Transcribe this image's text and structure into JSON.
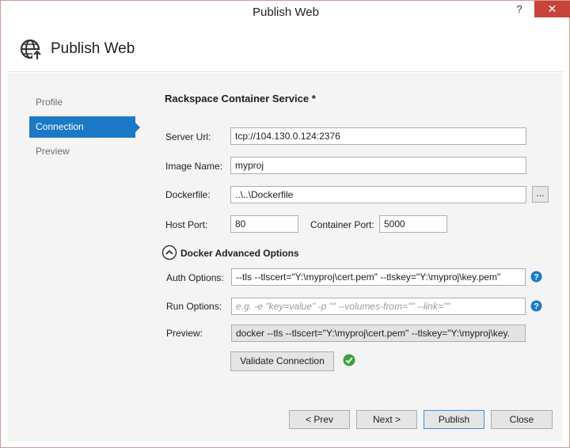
{
  "window": {
    "title": "Publish Web",
    "help_glyph": "?",
    "close_glyph": "✕"
  },
  "header": {
    "title": "Publish Web",
    "icon": "globe-publish-icon"
  },
  "nav": {
    "items": [
      {
        "label": "Profile",
        "active": false
      },
      {
        "label": "Connection",
        "active": true
      },
      {
        "label": "Preview",
        "active": false
      }
    ]
  },
  "form": {
    "section_title": "Rackspace Container Service *",
    "server_url": {
      "label": "Server Url:",
      "value": "tcp://104.130.0.124:2376"
    },
    "image_name": {
      "label": "Image Name:",
      "value": "myproj"
    },
    "dockerfile": {
      "label": "Dockerfile:",
      "value": "..\\..\\Dockerfile",
      "browse_label": "..."
    },
    "host_port": {
      "label": "Host Port:",
      "value": "80"
    },
    "container_port": {
      "label": "Container Port:",
      "value": "5000"
    },
    "advanced": {
      "label": "Docker Advanced Options",
      "expanded": true,
      "auth_options": {
        "label": "Auth Options:",
        "value": "--tls --tlscert=\"Y:\\myproj\\cert.pem\" --tlskey=\"Y:\\myproj\\key.pem\""
      },
      "run_options": {
        "label": "Run Options:",
        "value": "",
        "placeholder": "e.g. -e \"key=value\" -p \"\" --volumes-from=\"\" --link=\"\""
      },
      "preview": {
        "label": "Preview:",
        "value": "docker --tls --tlscert=\"Y:\\myproj\\cert.pem\" --tlskey=\"Y:\\myproj\\key."
      }
    },
    "validate_label": "Validate Connection",
    "validated": true
  },
  "footer": {
    "prev_label": "< Prev",
    "next_label": "Next >",
    "publish_label": "Publish",
    "close_label": "Close"
  },
  "colors": {
    "accent": "#1c79c6",
    "close_button": "#c7443a",
    "help_icon": "#1c79c6",
    "success": "#3aa23a"
  }
}
